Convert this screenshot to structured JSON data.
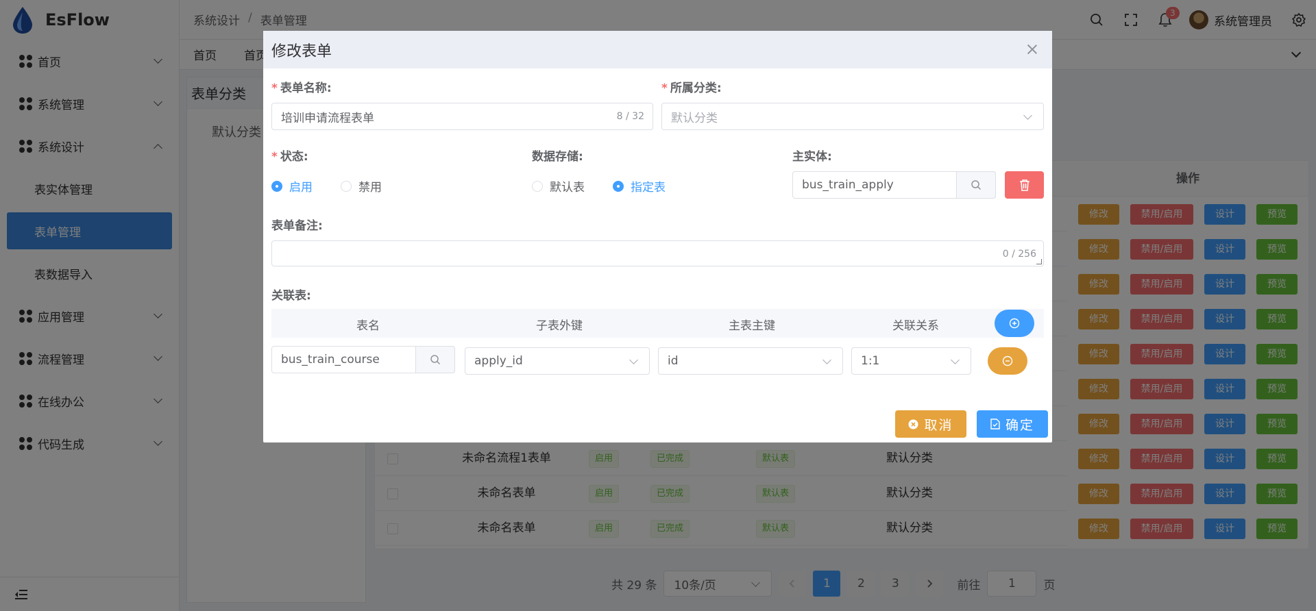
{
  "app": {
    "name": "EsFlow"
  },
  "sidebar": {
    "items": [
      {
        "label": "首页"
      },
      {
        "label": "系统管理"
      },
      {
        "label": "系统设计"
      },
      {
        "label": "应用管理"
      },
      {
        "label": "流程管理"
      },
      {
        "label": "在线办公"
      },
      {
        "label": "代码生成"
      }
    ],
    "sub_items": [
      {
        "label": "表实体管理"
      },
      {
        "label": "表单管理"
      },
      {
        "label": "表数据导入"
      }
    ]
  },
  "header": {
    "breadcrumb": [
      "系统设计",
      "表单管理"
    ],
    "breadcrumb_sep": "/",
    "notification_count": "3",
    "user_name": "系统管理员"
  },
  "tabs": [
    "首页",
    "首页"
  ],
  "category_panel": {
    "title": "表单分类",
    "items": [
      "默认分类"
    ]
  },
  "table": {
    "ops_header": "操作",
    "op_labels": {
      "edit": "修改",
      "toggle": "禁用/启用",
      "design": "设计",
      "preview": "预览"
    },
    "rows": [
      {
        "name": "未命名流程1表单",
        "status": "启用",
        "progress": "已完成",
        "storage": "默认表",
        "category": "默认分类"
      },
      {
        "name": "未命名表单",
        "status": "启用",
        "progress": "已完成",
        "storage": "默认表",
        "category": "默认分类"
      },
      {
        "name": "未命名表单",
        "status": "启用",
        "progress": "已完成",
        "storage": "默认表",
        "category": "默认分类"
      }
    ]
  },
  "pagination": {
    "total": "共 29 条",
    "page_size": "10条/页",
    "pages": [
      "1",
      "2",
      "3"
    ],
    "goto_prefix": "前往",
    "goto_value": "1",
    "goto_suffix": "页"
  },
  "dialog": {
    "title": "修改表单",
    "form_name_label": "表单名称:",
    "form_name_value": "培训申请流程表单",
    "form_name_count": "8 / 32",
    "category_label": "所属分类:",
    "category_placeholder": "默认分类",
    "status_label": "状态:",
    "status_options": [
      "启用",
      "禁用"
    ],
    "storage_label": "数据存储:",
    "storage_options": [
      "默认表",
      "指定表"
    ],
    "entity_label": "主实体:",
    "entity_value": "bus_train_apply",
    "remark_label": "表单备注:",
    "remark_count": "0 / 256",
    "relation_label": "关联表:",
    "relation_headers": [
      "表名",
      "子表外键",
      "主表主键",
      "关联关系"
    ],
    "relation_row": {
      "table": "bus_train_course",
      "child_key": "apply_id",
      "master_key": "id",
      "relation": "1:1"
    },
    "cancel_label": "取消",
    "confirm_label": "确定"
  },
  "colors": {
    "primary": "#409eff",
    "warning": "#e6a23c",
    "danger": "#f56c6c",
    "success": "#67c23a",
    "sidebar_active": "#3a87dd"
  }
}
